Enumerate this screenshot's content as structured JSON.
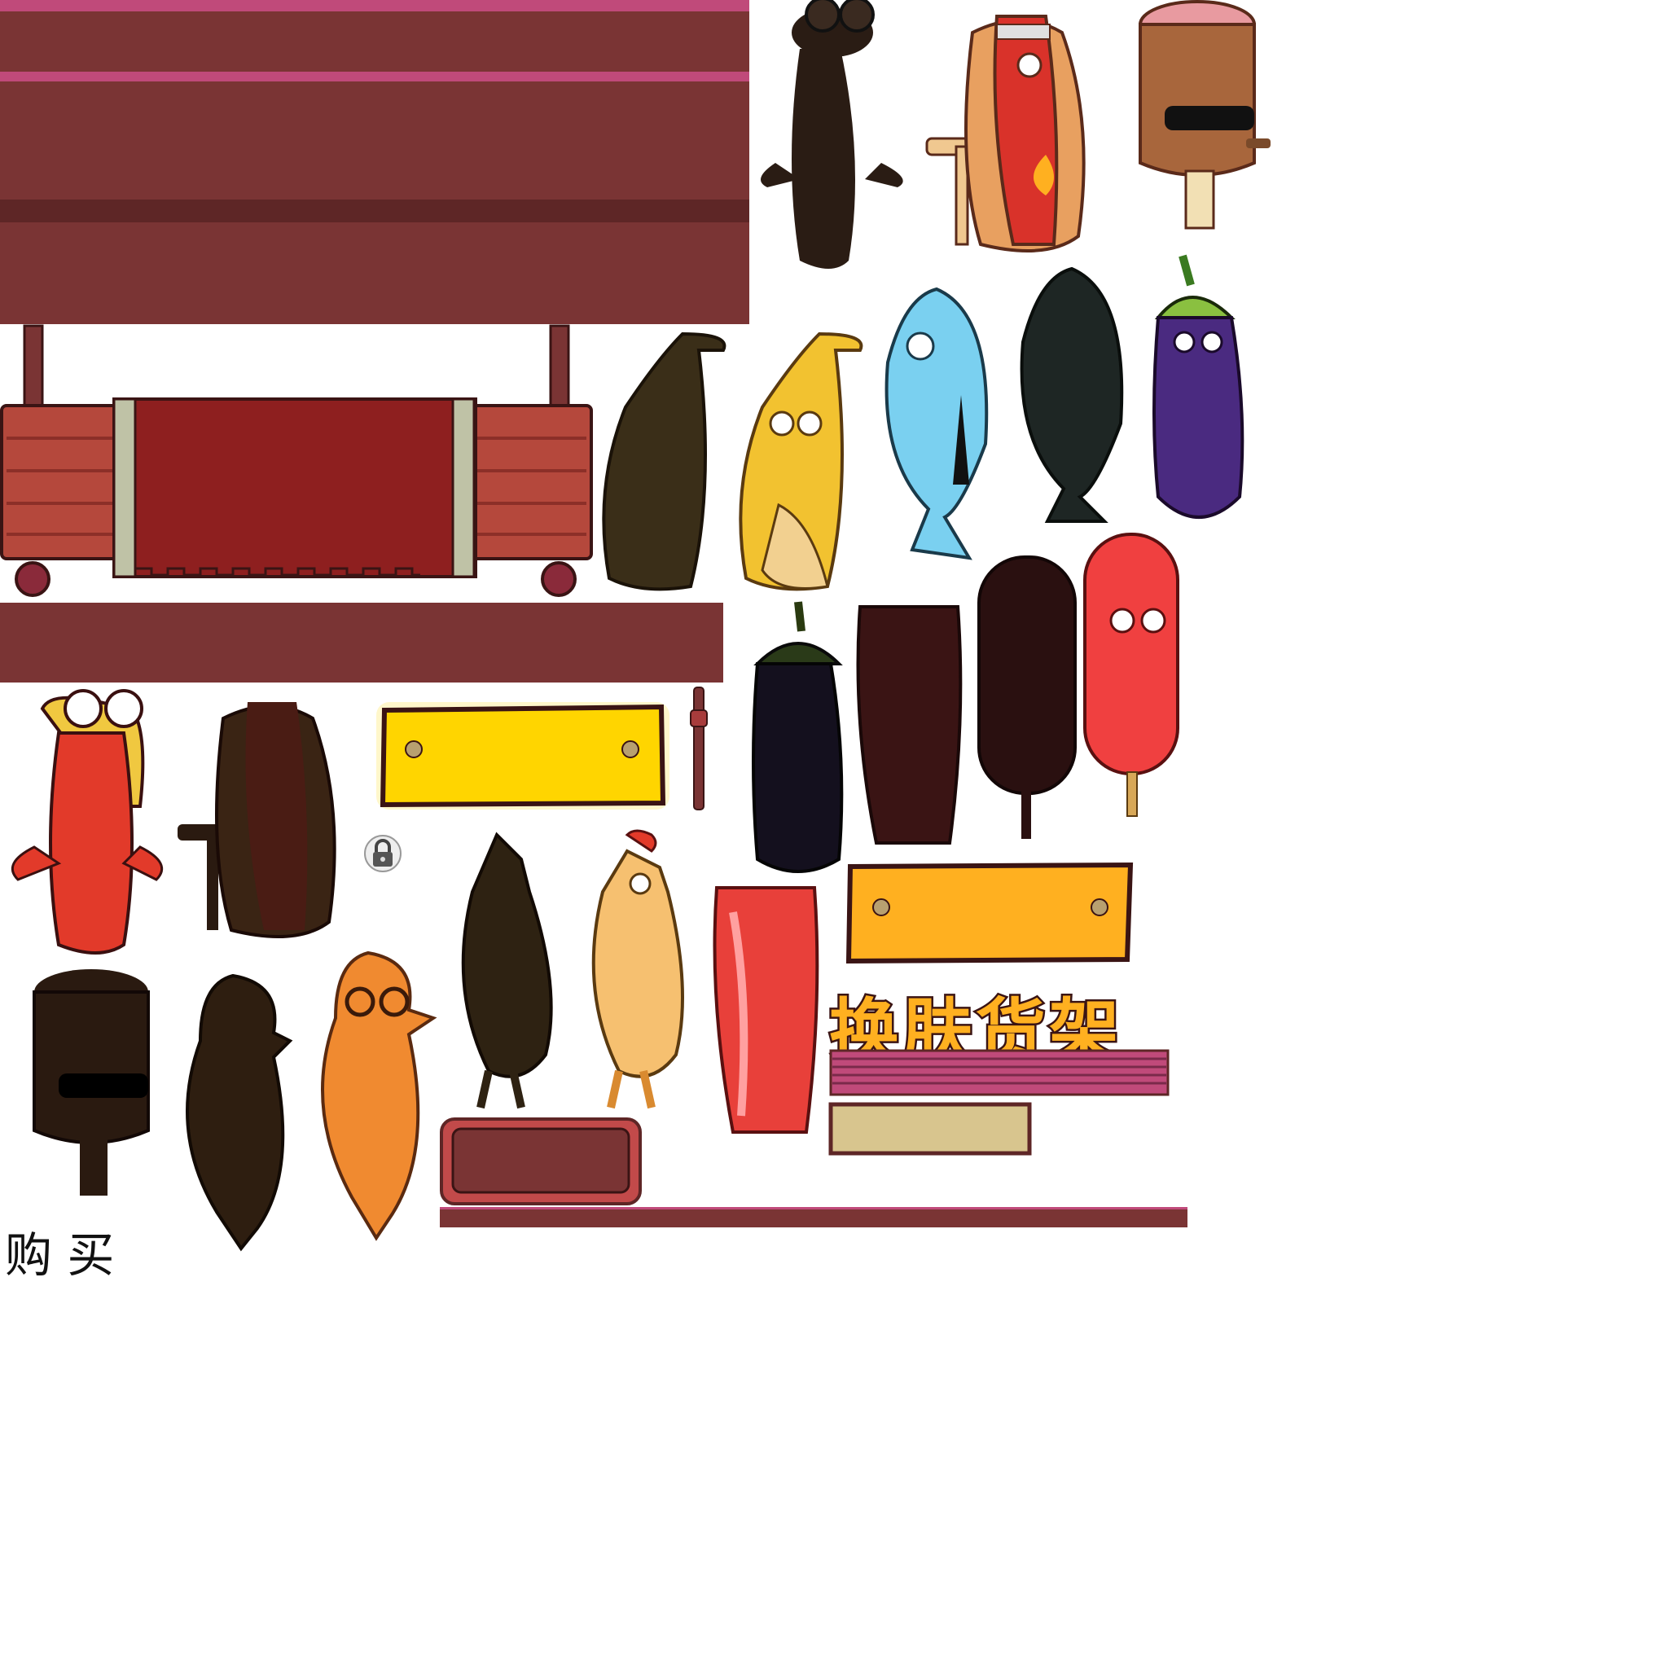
{
  "atlas": {
    "shelf_title": "换肤货架",
    "buy_label": "购 买"
  },
  "colors": {
    "panel_red": "#7a3434",
    "panel_pink_stripe": "#c04a7a",
    "panel_dark_stripe": "#5e2626",
    "cart_wood": "#b5483c",
    "cart_cloth": "#8e1f1f",
    "cart_trim": "#bfc2a6",
    "plank_yellow": "#ffd500",
    "plank_orange": "#ffb020",
    "title_orange": "#ffb020",
    "cream_panel": "#d8c58e"
  },
  "sprites": {
    "lobster_shadow": "lobster-silhouette",
    "hotdog_crutch": "hotdog-with-crutch",
    "ham_sunglasses": "ham-leg-with-sunglasses",
    "banana_shadow": "banana-silhouette",
    "banana": "banana",
    "fish_blue": "blue-fish-with-tie",
    "fish_shadow": "fish-silhouette",
    "eggplant": "eggplant-with-helmet",
    "eggplant_shadow": "eggplant-silhouette",
    "bacon_shadow": "bacon-silhouette",
    "sausage_shadow": "sausage-stick-silhouette",
    "sausage_red": "red-sausage-on-stick",
    "lobster_red": "red-lobster-blonde",
    "hotdog_shadow": "hotdog-silhouette",
    "chicken_shadow": "chicken-silhouette",
    "chicken": "rubber-chicken",
    "bacon_red": "red-bacon",
    "ham_shadow": "ham-silhouette",
    "duck_shadow": "duck-silhouette",
    "duck_orange": "orange-duck-with-glasses",
    "lock": "lock-icon"
  }
}
